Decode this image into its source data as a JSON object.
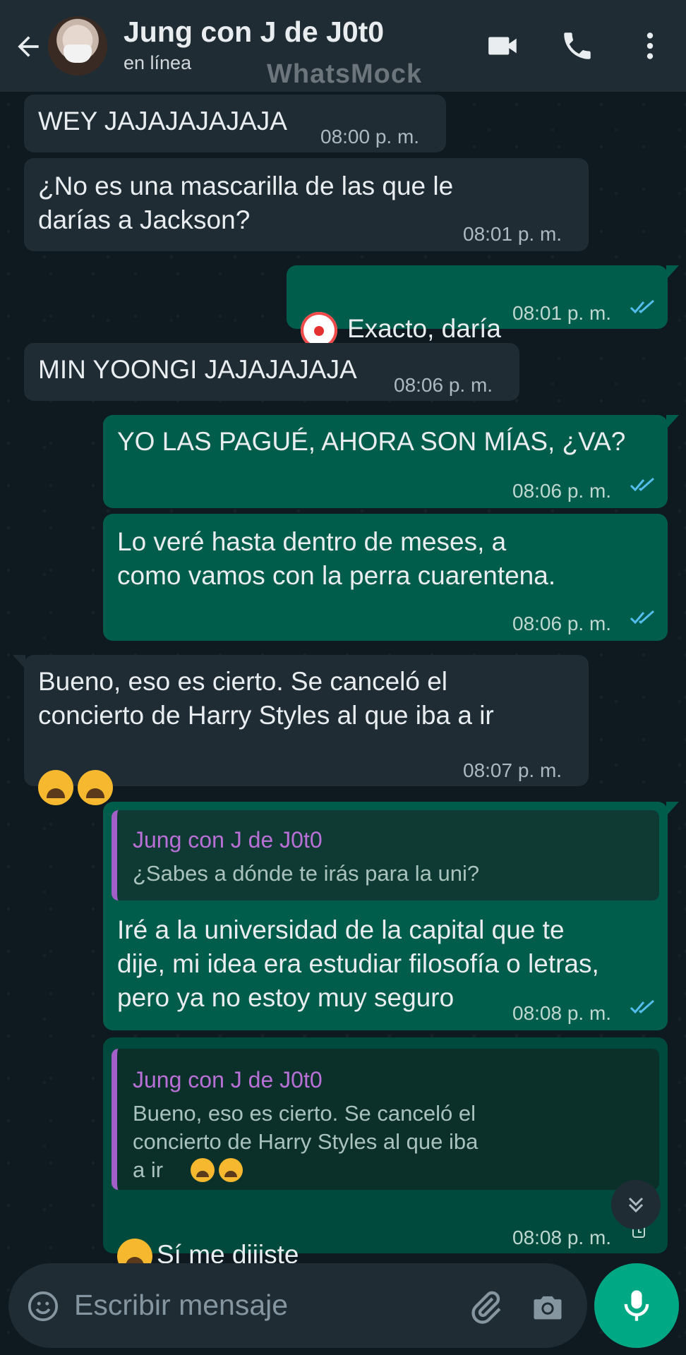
{
  "header": {
    "contact_name": "Jung con J de J0t0",
    "status": "en línea",
    "watermark": "WhatsMock"
  },
  "messages": [
    {
      "dir": "in",
      "text": "WEY JAJAJAJAJAJA",
      "time": "08:00 p. m."
    },
    {
      "dir": "in",
      "text": "¿No es una mascarilla de las que le\ndarías a Jackson?",
      "time": "08:01 p. m."
    },
    {
      "dir": "out",
      "emoji": "clown-face",
      "text": "Exacto, daría",
      "time": "08:01 p. m.",
      "status": "read"
    },
    {
      "dir": "in",
      "text": "MIN YOONGI JAJAJAJAJA",
      "time": "08:06 p. m."
    },
    {
      "dir": "out",
      "text": "YO LAS PAGUÉ, AHORA SON MÍAS, ¿VA?",
      "time": "08:06 p. m.",
      "status": "read"
    },
    {
      "dir": "out",
      "text": "Lo veré hasta dentro de meses, a\ncomo vamos con la perra cuarentena.",
      "time": "08:06 p. m.",
      "status": "read"
    },
    {
      "dir": "in",
      "text": "Bueno, eso es cierto. Se canceló el\nconcierto de Harry Styles al que iba a ir",
      "emoji": "weary-face x2",
      "time": "08:07 p. m."
    },
    {
      "dir": "out",
      "quote_author": "Jung con J de J0t0",
      "quote_text": "¿Sabes a dónde te irás para la uni?",
      "text": "Iré a la universidad de la capital que te\ndije, mi idea era estudiar filosofía o letras,\npero ya no estoy muy seguro",
      "time": "08:08 p. m.",
      "status": "read"
    },
    {
      "dir": "out",
      "quote_author": "Jung con J de J0t0",
      "quote_text": "Bueno, eso es cierto. Se canceló el\nconcierto de Harry Styles al que iba\na ir",
      "emoji": "weary-face",
      "text": "Sí me dijiste",
      "time": "08:08 p. m.",
      "status": "pending"
    }
  ],
  "composer": {
    "placeholder": "Escribir mensaje",
    "icons": [
      "emoji-icon",
      "attach-icon",
      "camera-icon",
      "mic-icon"
    ]
  },
  "colors": {
    "header_bg": "#1f2c33",
    "incoming_bubble": "#1f2c34",
    "outgoing_bubble": "#005c4b",
    "read_ticks": "#53bdeb",
    "quote_author": "#b870d6",
    "mic_button": "#00a884"
  }
}
